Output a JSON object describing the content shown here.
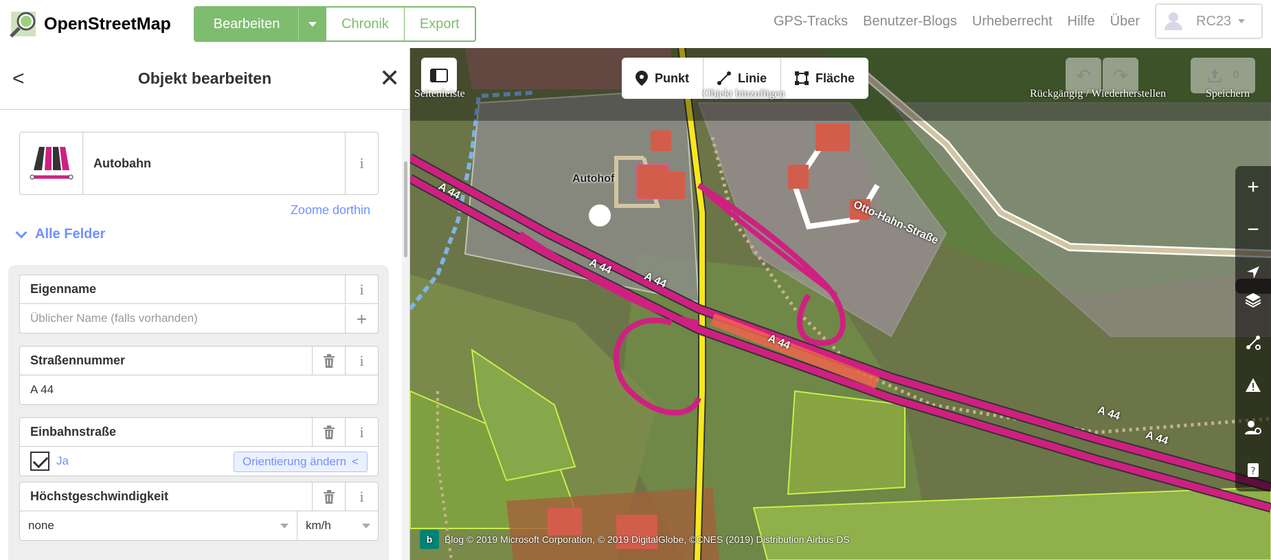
{
  "nav": {
    "logo_text": "OpenStreetMap",
    "edit_label": "Bearbeiten",
    "history_label": "Chronik",
    "export_label": "Export",
    "links": [
      "GPS-Tracks",
      "Benutzer-Blogs",
      "Urheberrecht",
      "Hilfe",
      "Über"
    ],
    "user": "RC23"
  },
  "sidebar": {
    "title": "Objekt bearbeiten",
    "preset_name": "Autobahn",
    "info_glyph": "i",
    "zoom_link": "Zoome dorthin",
    "all_fields": "Alle Felder",
    "fields": {
      "name_label": "Eigenname",
      "name_placeholder": "Üblicher Name (falls vorhanden)",
      "ref_label": "Straßennummer",
      "ref_value": "A 44",
      "oneway_label": "Einbahnstraße",
      "oneway_value": "Ja",
      "oneway_reverse": "Orientierung ändern",
      "maxspeed_label": "Höchstgeschwindigkeit",
      "maxspeed_value": "none",
      "maxspeed_unit": "km/h"
    }
  },
  "map": {
    "sidebar_toggle_label": "Seitenleiste",
    "modes": [
      "Punkt",
      "Linie",
      "Fläche"
    ],
    "add_feature_label": "Objekt hinzufügen",
    "undo_redo_label": "Rückgängig / Wiederherstellen",
    "save_label": "Speichern",
    "save_count": "0",
    "labels": {
      "autohof": "Autohof",
      "street": "Otto-Hahn-Straße",
      "a44_1": "A 44",
      "a44_2": "A 44",
      "a44_3": "A 44",
      "a44_4": "A 44",
      "a44_5": "A 44",
      "a44_6": "A 44"
    },
    "attribution_logo": "b",
    "attribution": "Blog  © 2019 Microsoft Corporation, © 2019 DigitalGlobe, ©CNES (2019) Distribution Airbus DS"
  },
  "colors": {
    "accent": "#7ebc6f",
    "link": "#7092ff",
    "motorway": "#cf2081",
    "primary_road": "#f8e71c"
  }
}
